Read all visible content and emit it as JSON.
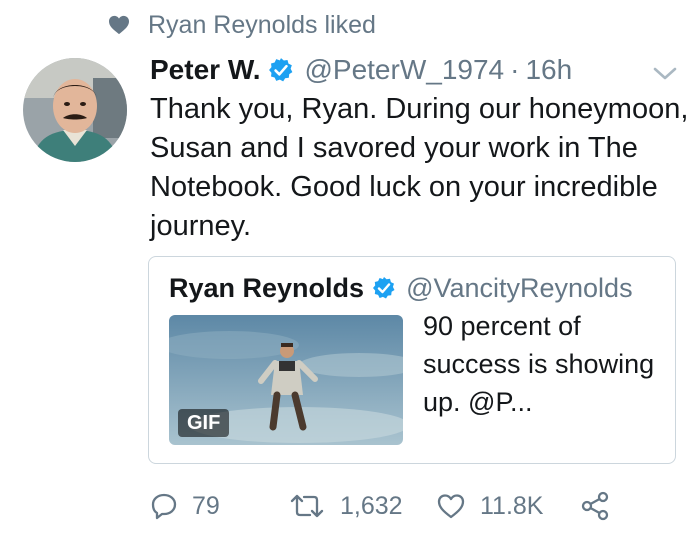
{
  "context": {
    "icon": "heart-icon",
    "text": "Ryan Reynolds liked"
  },
  "tweet": {
    "author_name": "Peter W.",
    "handle": "@PeterW_1974",
    "separator": "·",
    "time": "16h",
    "text": "Thank you, Ryan. During our honeymoon, Susan and I savored your work in The Notebook. Good luck on your incredible journey."
  },
  "quoted_tweet": {
    "author_name": "Ryan Reynolds",
    "handle": "@VancityReynolds",
    "media_badge": "GIF",
    "text": "90 percent of success is showing up. @P..."
  },
  "actions": {
    "reply_count": "79",
    "retweet_count": "1,632",
    "like_count": "11.8K"
  },
  "colors": {
    "text": "#14171a",
    "secondary": "#657786",
    "verified": "#1da1f2",
    "border": "#ccd6dd"
  }
}
